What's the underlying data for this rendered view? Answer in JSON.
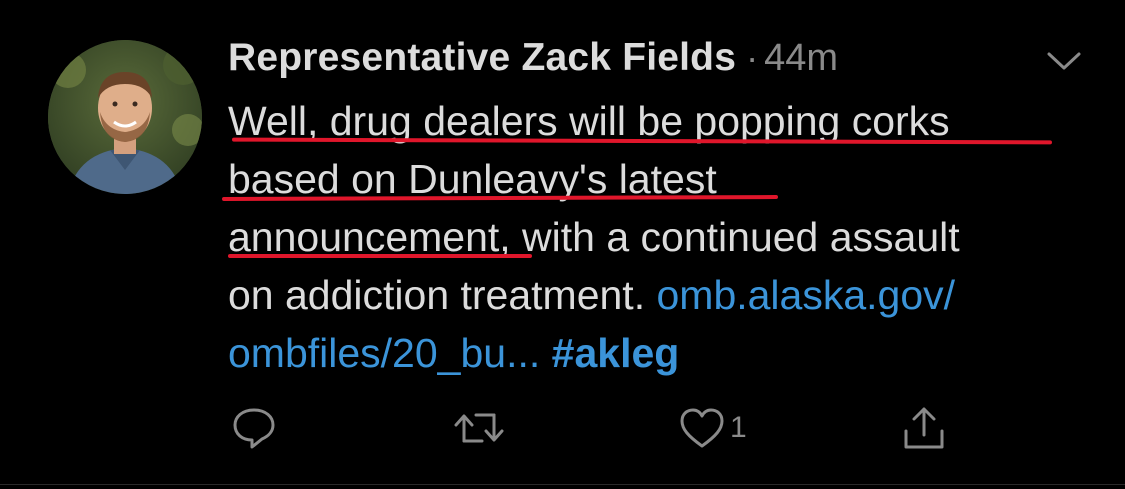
{
  "tweet": {
    "author_name": "Representative Zack Fields",
    "separator": "·",
    "timestamp": "44m",
    "text_lines": [
      "Well, drug dealers will be popping corks",
      "based on Dunleavy's latest",
      "announcement, with a continued assault",
      "on addiction treatment. "
    ],
    "link_part1": "omb.alaska.gov/",
    "link_part2": "ombfiles/20_bu...",
    "hashtag": "#akleg",
    "like_count": "1"
  },
  "icons": {
    "avatar": "avatar",
    "more": "chevron-down-icon",
    "reply": "reply-icon",
    "retweet": "retweet-icon",
    "like": "heart-icon",
    "share": "share-icon"
  },
  "colors": {
    "background": "#000000",
    "text": "#dcdcdc",
    "muted": "#8a8a8a",
    "link": "#3b94d9",
    "underline_annotation": "#e0162b"
  }
}
